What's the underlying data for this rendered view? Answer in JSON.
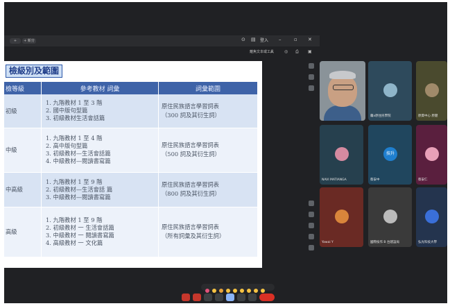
{
  "browser": {
    "tab_plus": "+",
    "tab_label": "+ 新分",
    "win_controls": [
      "⊙",
      "▤",
      "登入",
      "–",
      "▫",
      "✕"
    ],
    "toolbar_label": "離焦文本或工具"
  },
  "slide": {
    "title": "檢級別及範圍",
    "headers": [
      "檢等級",
      "參考教材 詞彙",
      "詞彙範圍"
    ],
    "rows": [
      {
        "level": "初級",
        "materials": [
          "1. 九階教材 1 至 3 階",
          "2. 國中版句型篇",
          "3. 初級教材生活會話篇"
        ],
        "range": [
          "原住民族語言學習詞表",
          "（300 詞及其衍生詞）"
        ]
      },
      {
        "level": "中級",
        "materials": [
          "1. 九階教材 1 至 4 階",
          "2. 高中版句型篇",
          "3. 初級教材—生活會話篇",
          "4. 中級教材—閱讀書寫篇"
        ],
        "range": [
          "原住民族語言學習詞表",
          "（500 詞及其衍生詞）"
        ]
      },
      {
        "level": "中高級",
        "materials": [
          "1. 九階教材 1 至 9 階",
          "2. 初級教材—生活會話 篇",
          "3. 中級教材—閱讀書寫篇"
        ],
        "range": [
          "原住民族語言學習詞表",
          "（800 詞及其衍生詞）"
        ]
      },
      {
        "level": "高級",
        "materials": [
          "1. 九階教材 1 至 9 階",
          "2. 初級教材 一 生活會話篇",
          "3. 中級教材 一 閱讀書寫篇",
          "4. 高級教材 一 文化篇"
        ],
        "range": [
          "原住民族語言學習詞表",
          "（所有詞彙及其衍生詞）"
        ]
      }
    ]
  },
  "participants": [
    {
      "name": "",
      "color": "#8a9399",
      "self": true
    },
    {
      "name": "蘿x原住民學院",
      "color": "#2e4a5c",
      "avatar_color": "#8fb5c9"
    },
    {
      "name": "原資中心 原健",
      "color": "#4a4a2e",
      "avatar_color": "#a08a6a"
    },
    {
      "name": "NAVI MATIANGA",
      "color": "#26404e",
      "avatar_color": "#d48aa0"
    },
    {
      "name": "蔡安中",
      "color": "#20465e",
      "avatar_color": "#1f7fcf",
      "avatar_text": "技升"
    },
    {
      "name": "蔡安仁",
      "color": "#5a1f3e",
      "avatar_color": "#e8a0b8"
    },
    {
      "name": "Yawai Y",
      "color": "#6a2a24",
      "avatar_color": "#d9853b"
    },
    {
      "name": "國際技作 B 台建設局",
      "color": "#3a3a3a",
      "avatar_color": "#bbbbbb"
    },
    {
      "name": "弘光科技大學",
      "color": "#24344e",
      "avatar_color": "#3a6fd8"
    }
  ],
  "reactions": [
    "💖",
    "👍",
    "🎉",
    "👏",
    "😂",
    "😮",
    "😢",
    "🤔",
    "👎"
  ],
  "controls": [
    "mic-button",
    "camera-button",
    "captions-button",
    "emoji-button",
    "present-button",
    "raise-hand-button",
    "more-button",
    "leave-button"
  ]
}
